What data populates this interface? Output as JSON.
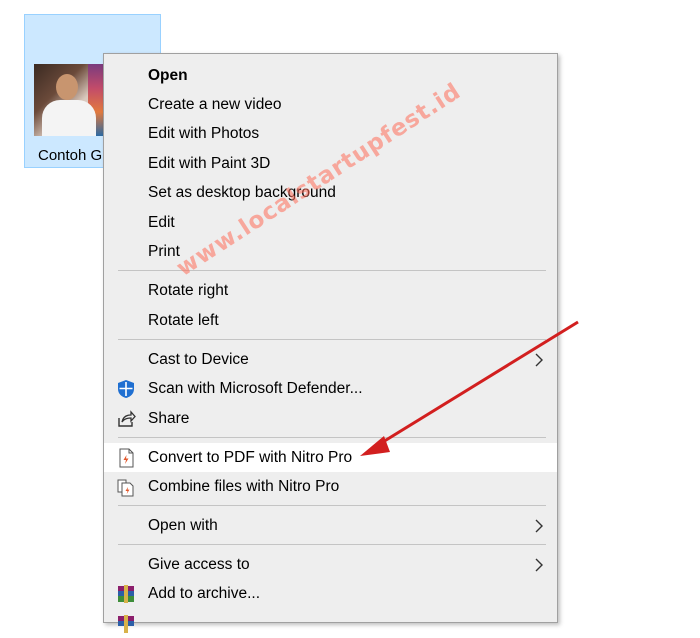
{
  "file": {
    "name": "Contoh G"
  },
  "menu": {
    "items": [
      {
        "label": "Open"
      },
      {
        "label": "Create a new video"
      },
      {
        "label": "Edit with Photos"
      },
      {
        "label": "Edit with Paint 3D"
      },
      {
        "label": "Set as desktop background"
      },
      {
        "label": "Edit"
      },
      {
        "label": "Print"
      },
      {
        "label": "Rotate right"
      },
      {
        "label": "Rotate left"
      },
      {
        "label": "Cast to Device"
      },
      {
        "label": "Scan with Microsoft Defender..."
      },
      {
        "label": "Share"
      },
      {
        "label": "Convert to PDF with Nitro Pro"
      },
      {
        "label": "Combine files with Nitro Pro"
      },
      {
        "label": "Open with"
      },
      {
        "label": "Give access to"
      },
      {
        "label": "Add to archive..."
      }
    ]
  },
  "watermark": "www.localstartupfest.id",
  "colors": {
    "selection": "#cce8ff",
    "menu_bg": "#eeeeee",
    "highlight": "#ffffff",
    "arrow": "#d21f1f",
    "defender_blue": "#1f6fd1",
    "nitro_orange": "#e2572b"
  }
}
